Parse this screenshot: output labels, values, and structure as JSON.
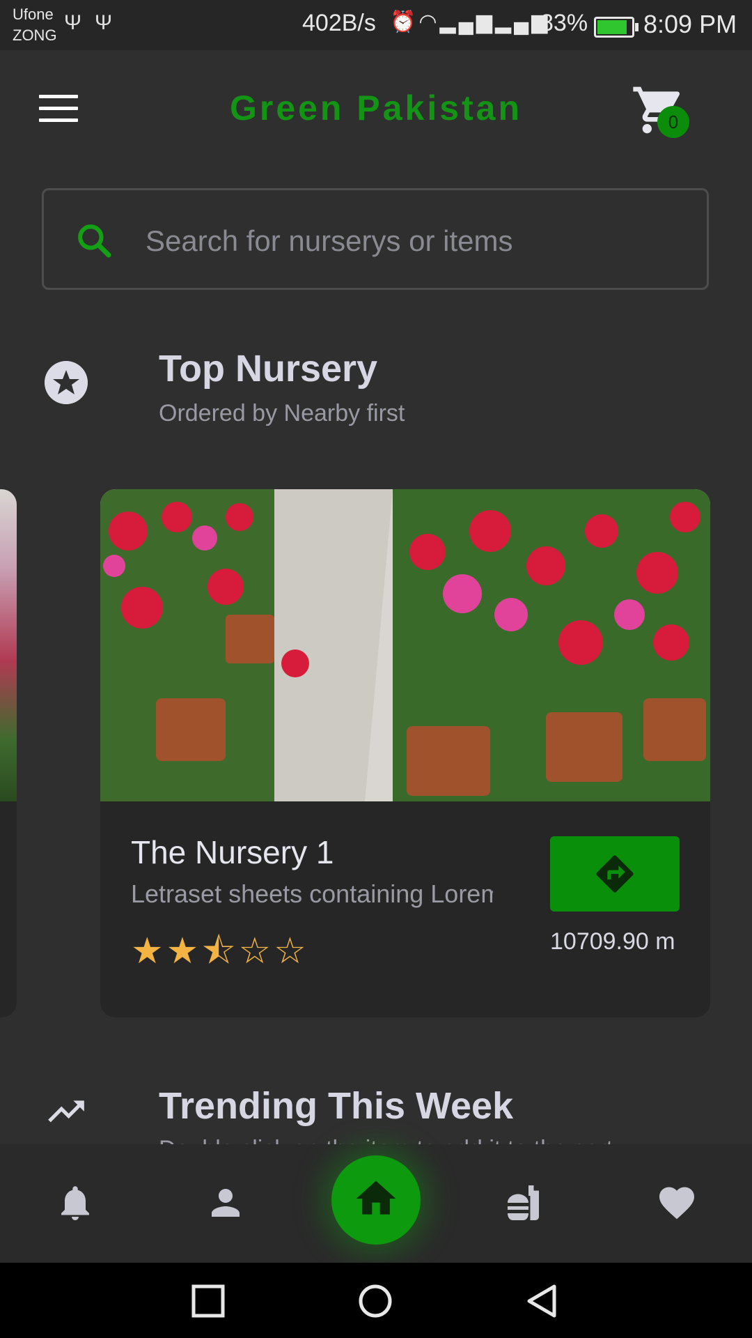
{
  "status_bar": {
    "carrier_1": "Ufone",
    "carrier_2": "ZONG",
    "net_speed": "402B/s",
    "battery_pct": "83%",
    "time": "8:09 PM",
    "icons": [
      "usb-icon",
      "usb-icon",
      "alarm-icon",
      "wifi-icon",
      "signal-2g-icon",
      "signal-3g-icon",
      "battery-charging-icon"
    ]
  },
  "app_bar": {
    "title": "Green Pakistan",
    "cart_count": "0",
    "accent_color": "#149414"
  },
  "search": {
    "placeholder": "Search for nurserys or items"
  },
  "top_nursery": {
    "title": "Top Nursery",
    "subtitle": "Ordered by Nearby first"
  },
  "nursery_card": {
    "name": "The Nursery 1",
    "description": "Letraset sheets containing Lorem",
    "rating": 2.5,
    "rating_max": 5,
    "distance": "10709.90 m"
  },
  "trending": {
    "title": "Trending This Week",
    "subtitle": "Double click on the item to add it to the cart"
  },
  "bottom_nav": {
    "items": [
      "bell-icon",
      "person-icon",
      "home-icon",
      "food-icon",
      "heart-icon"
    ]
  }
}
